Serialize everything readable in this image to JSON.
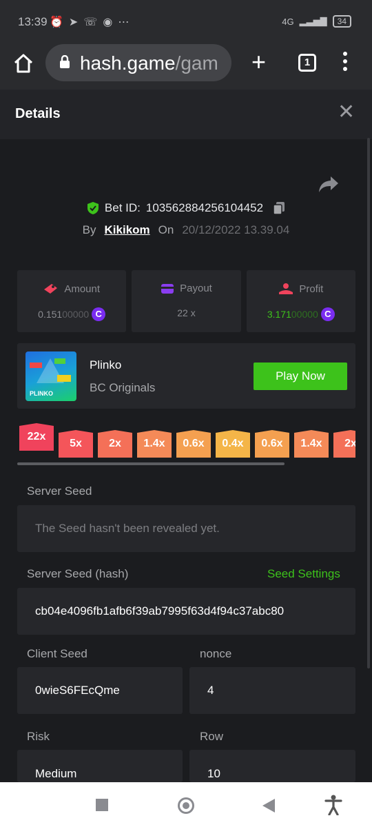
{
  "status_bar": {
    "time": "13:39",
    "network": "4G",
    "battery": "34"
  },
  "browser": {
    "url_domain": "hash.game",
    "url_path": "/gam",
    "tab_count": "1"
  },
  "header": {
    "title": "Details"
  },
  "bet": {
    "id_label": "Bet ID:",
    "id_value": "103562884256104452",
    "by_label": "By",
    "user": "Kikikom",
    "on_label": "On",
    "date": "20/12/2022 13.39.04"
  },
  "stats": {
    "amount": {
      "label": "Amount",
      "value_main": "0.151",
      "value_dim": "00000"
    },
    "payout": {
      "label": "Payout",
      "value": "22 x"
    },
    "profit": {
      "label": "Profit",
      "value_main": "3.171",
      "value_dim": "00000"
    },
    "coin_symbol": "C"
  },
  "game": {
    "name": "Plinko",
    "provider": "BC Originals",
    "thumb_label": "PLINKO",
    "play_label": "Play Now"
  },
  "multipliers": [
    {
      "label": "22x",
      "color": "#f0435c"
    },
    {
      "label": "5x",
      "color": "#f4555a"
    },
    {
      "label": "2x",
      "color": "#f47058"
    },
    {
      "label": "1.4x",
      "color": "#f48a58"
    },
    {
      "label": "0.6x",
      "color": "#f4a050"
    },
    {
      "label": "0.4x",
      "color": "#f4b548"
    },
    {
      "label": "0.6x",
      "color": "#f4a050"
    },
    {
      "label": "1.4x",
      "color": "#f48a58"
    },
    {
      "label": "2x",
      "color": "#f47058"
    }
  ],
  "fairness": {
    "server_seed_label": "Server Seed",
    "server_seed_value": "The Seed hasn't been revealed yet.",
    "server_hash_label": "Server Seed (hash)",
    "seed_settings_label": "Seed Settings",
    "server_hash_value": "cb04e4096fb1afb6f39ab7995f63d4f94c37abc80",
    "client_seed_label": "Client Seed",
    "client_seed_value": "0wieS6FEcQme",
    "nonce_label": "nonce",
    "nonce_value": "4",
    "risk_label": "Risk",
    "risk_value": "Medium",
    "row_label": "Row",
    "row_value": "10"
  },
  "colors": {
    "accent_green": "#3dc21b",
    "coin_purple": "#7a2df0",
    "panel": "#26272b",
    "background": "#1b1c1f"
  }
}
